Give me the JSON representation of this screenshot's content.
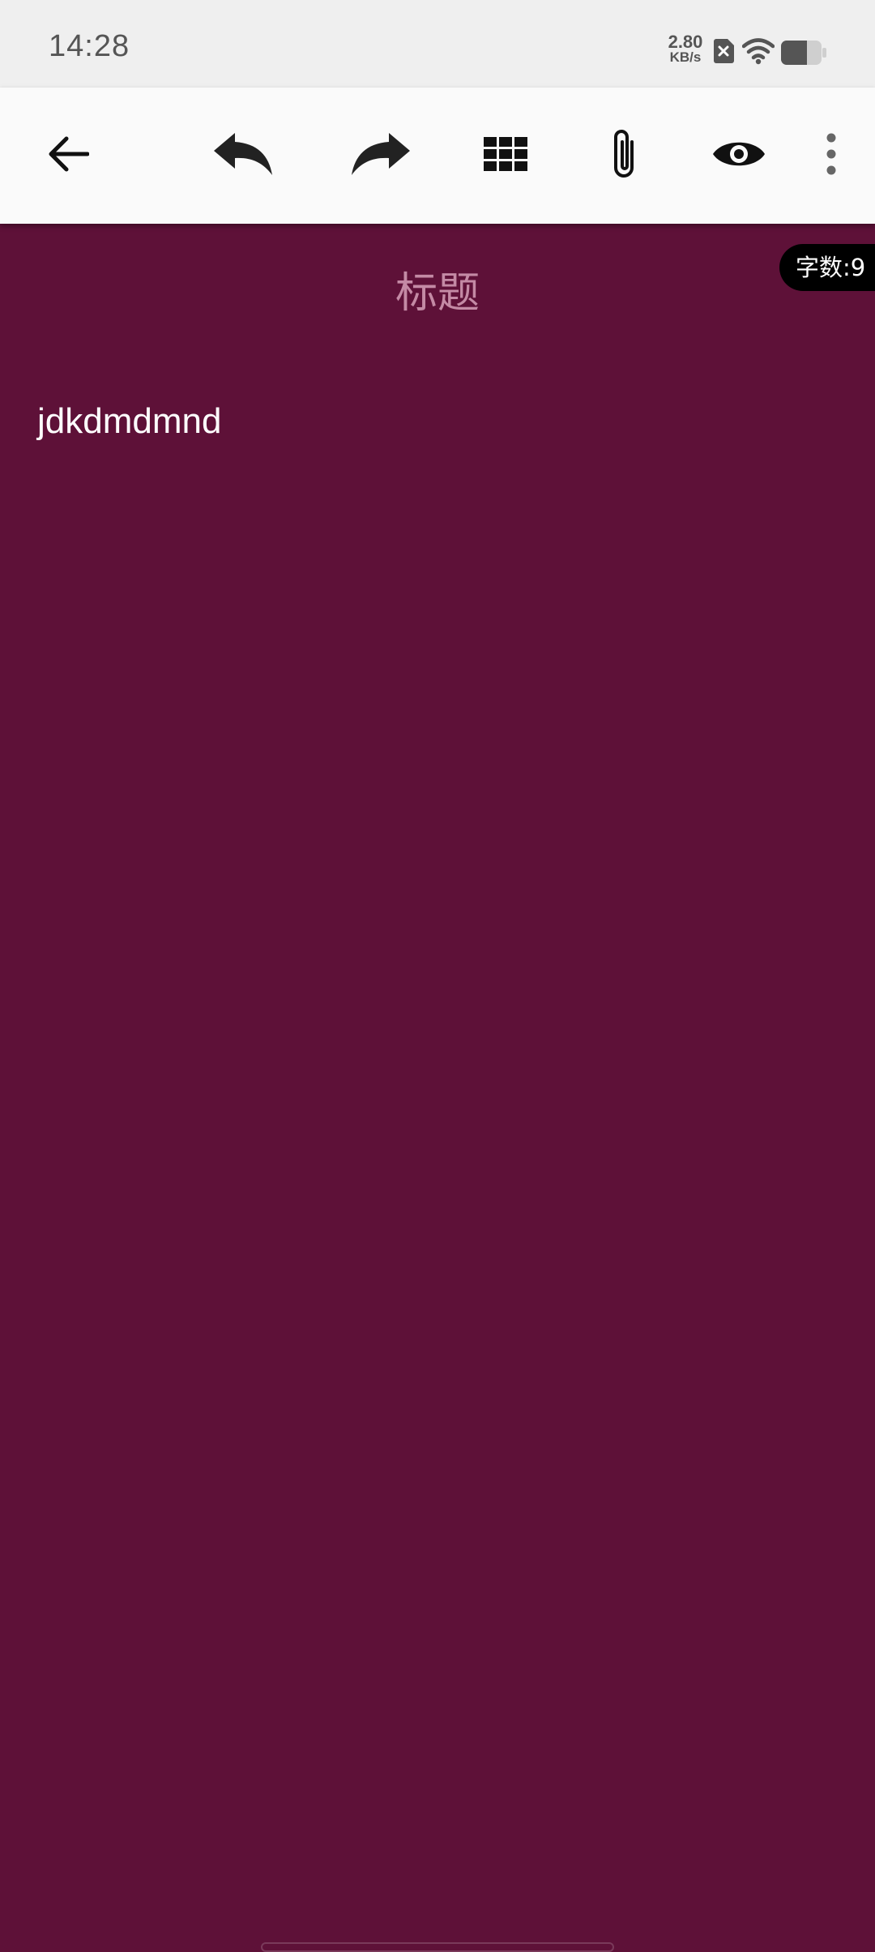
{
  "status_bar": {
    "time": "14:28",
    "net_speed_value": "2.80",
    "net_speed_unit": "KB/s",
    "icons": [
      "sim-error-icon",
      "wifi-icon",
      "battery-icon"
    ]
  },
  "toolbar": {
    "buttons": [
      "back-arrow-icon",
      "undo-icon",
      "redo-icon",
      "grid-icon",
      "attachment-icon",
      "preview-eye-icon",
      "more-vert-icon"
    ]
  },
  "editor": {
    "word_count": "字数:9",
    "title_placeholder": "标题",
    "body_text": "jdkdmdmnd"
  },
  "colors": {
    "background": "#5e1138",
    "toolbar": "#fafafa",
    "status_bar": "#efefef",
    "title_hint": "#c48aa5"
  }
}
